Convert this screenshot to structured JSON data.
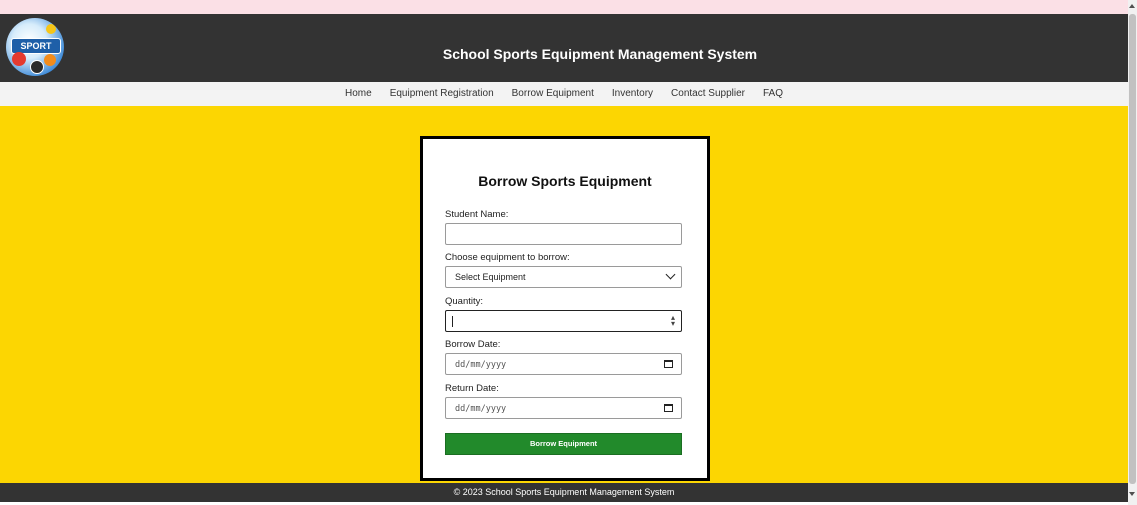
{
  "header": {
    "logo_text": "SPORT",
    "title": "School Sports Equipment Management System"
  },
  "nav": {
    "items": [
      "Home",
      "Equipment Registration",
      "Borrow Equipment",
      "Inventory",
      "Contact Supplier",
      "FAQ"
    ]
  },
  "form": {
    "heading": "Borrow Sports Equipment",
    "student_name_label": "Student Name:",
    "student_name_value": "",
    "equipment_label": "Choose equipment to borrow:",
    "equipment_selected": "Select Equipment",
    "quantity_label": "Quantity:",
    "quantity_value": "",
    "borrow_date_label": "Borrow Date:",
    "borrow_date_placeholder": "dd/mm/yyyy",
    "return_date_label": "Return Date:",
    "return_date_placeholder": "dd/mm/yyyy",
    "submit_label": "Borrow Equipment"
  },
  "footer": {
    "text": "© 2023 School Sports Equipment Management System"
  },
  "colors": {
    "header_bg": "#333333",
    "main_bg": "#fcd602",
    "button_bg": "#228a2b",
    "top_strip": "#fbe0e6"
  }
}
